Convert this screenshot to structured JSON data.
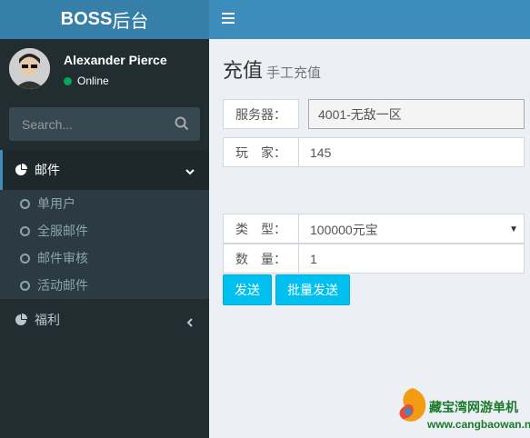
{
  "app": {
    "logo_bold": "BOSS",
    "logo_rest": "后台"
  },
  "user": {
    "name": "Alexander Pierce",
    "status": "Online"
  },
  "search": {
    "placeholder": "Search..."
  },
  "sidebar": {
    "mail": {
      "label": "邮件",
      "items": [
        {
          "label": "单用户"
        },
        {
          "label": "全服邮件"
        },
        {
          "label": "邮件审核"
        },
        {
          "label": "活动邮件"
        }
      ]
    },
    "welfare": {
      "label": "福利"
    }
  },
  "page": {
    "title": "充值",
    "subtitle": "手工充值"
  },
  "form": {
    "server_label": "服务器：",
    "server_value": "4001-无敌一区",
    "player_label": "玩　家：",
    "player_value": "145",
    "type_label": "类　型：",
    "type_value": "100000元宝",
    "qty_label": "数　量：",
    "qty_value": "1"
  },
  "buttons": {
    "send": "发送",
    "batch_send": "批量发送"
  },
  "watermark": {
    "line1": "藏宝湾网游单机",
    "line2": "www.cangbaowan.net"
  },
  "colors": {
    "topbar": "#3c8dbc",
    "logo_bg": "#367fa9",
    "sidebar": "#222d32",
    "button": "#00c0ef",
    "status_online": "#00a65a"
  }
}
